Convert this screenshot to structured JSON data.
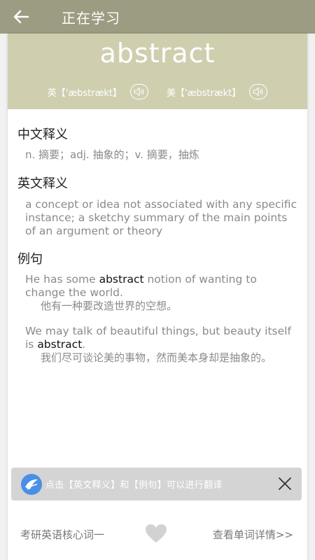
{
  "header": {
    "title": "正在学习",
    "back_icon": "arrow-left-icon"
  },
  "word": {
    "text": "abstract",
    "uk_label": "英【'æbstrækt】",
    "us_label": "美【'æbstrækt】"
  },
  "sections": {
    "cn_title": "中文释义",
    "cn_body": "n. 摘要；adj. 抽象的；v. 摘要，抽炼",
    "en_title": "英文释义",
    "en_body": "a concept or idea not associated with any specific instance; a sketchy summary of the main points of an argument or theory",
    "ex_title": "例句"
  },
  "examples": [
    {
      "pre": " He has some ",
      "word": "abstract",
      "post": " notion of wanting to change the world.",
      "cn": "他有一种要改造世界的空想。"
    },
    {
      "pre": " We may talk of beautiful things, but beauty itself is ",
      "word": "abstract",
      "post": ".",
      "cn": "我们尽可谈论美的事物，然而美本身却是抽象的。"
    }
  ],
  "toast": {
    "text": "点击【英文释义】和【例句】可以进行翻译"
  },
  "bottom": {
    "category": "考研英语核心词一",
    "details_link": "查看单词详情>>"
  },
  "colors": {
    "topbar": "#9c9c82",
    "word_header": "#cfcfb0",
    "toast_bg": "#d4d4d4",
    "logo_blue": "#4a8fe6"
  }
}
